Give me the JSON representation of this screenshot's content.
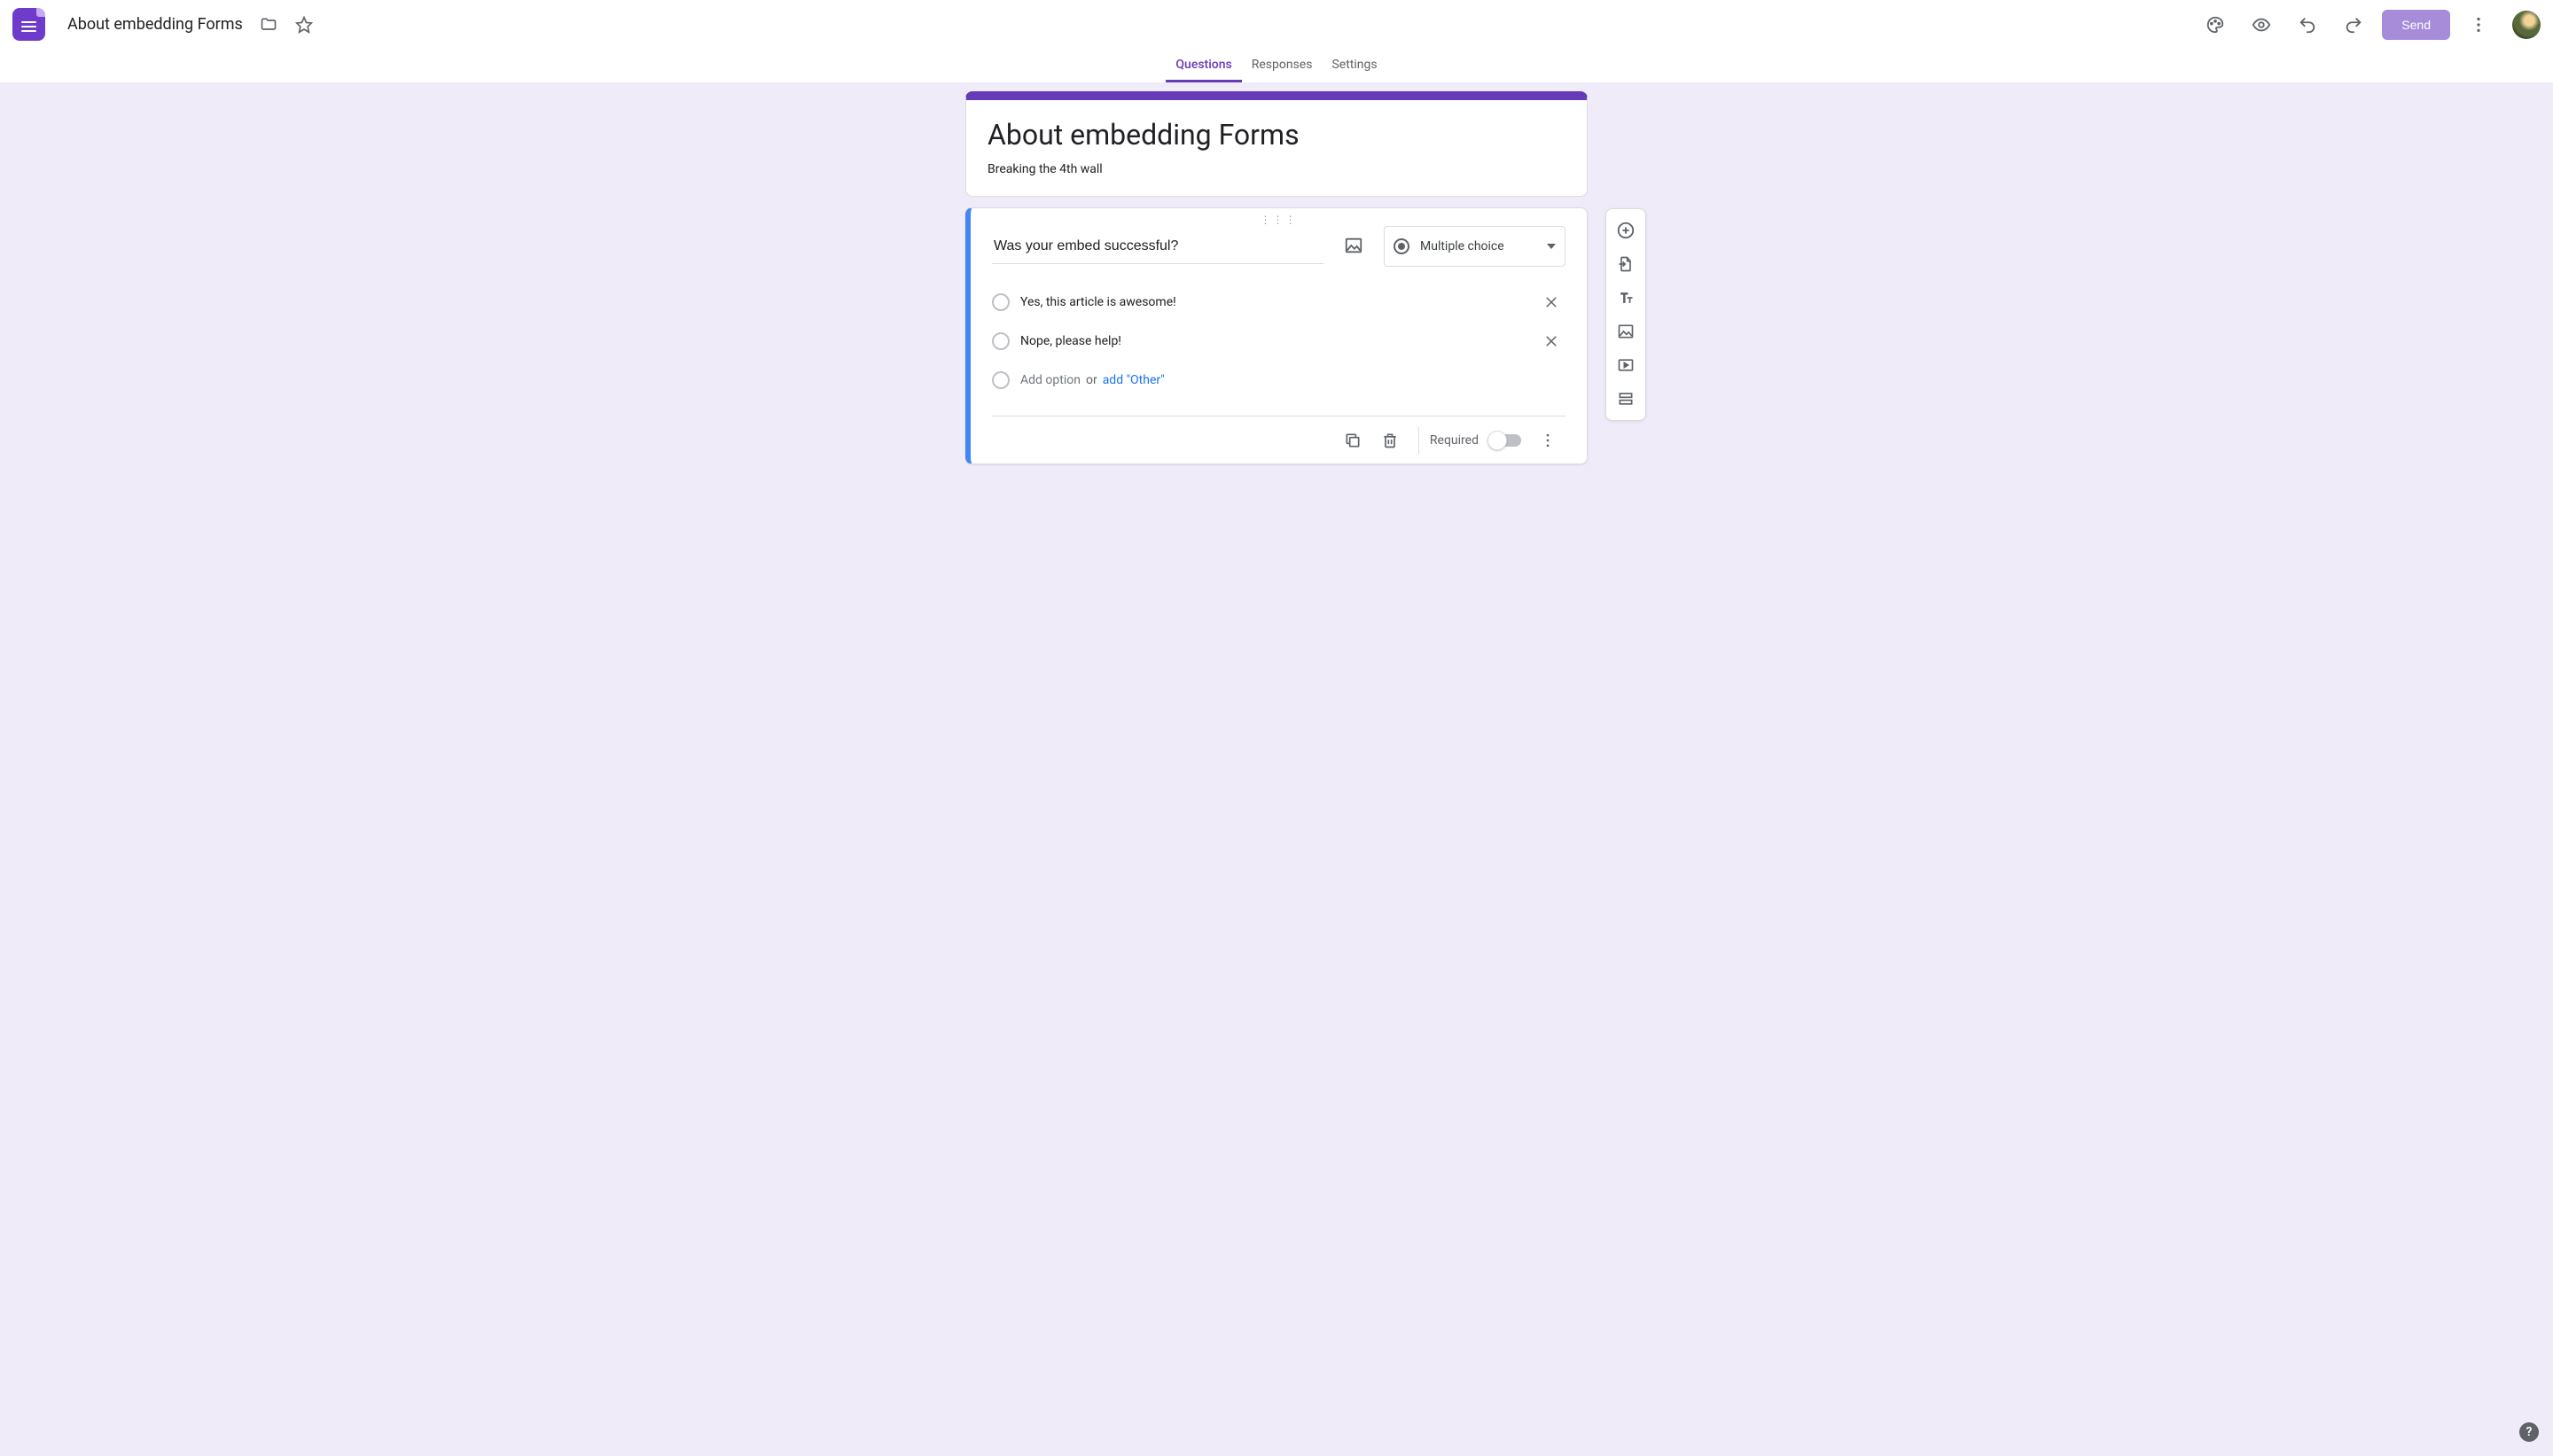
{
  "header": {
    "doc_title": "About embedding Forms",
    "send_label": "Send"
  },
  "tabs": {
    "questions": "Questions",
    "responses": "Responses",
    "settings": "Settings"
  },
  "form": {
    "title": "About embedding Forms",
    "description": "Breaking the 4th wall"
  },
  "question": {
    "text": "Was your embed successful?",
    "type_label": "Multiple choice",
    "options": [
      "Yes, this article is awesome!",
      "Nope, please help!"
    ],
    "add_option_placeholder": "Add option",
    "or_label": "or",
    "add_other_label": "add \"Other\"",
    "required_label": "Required"
  },
  "help_glyph": "?"
}
